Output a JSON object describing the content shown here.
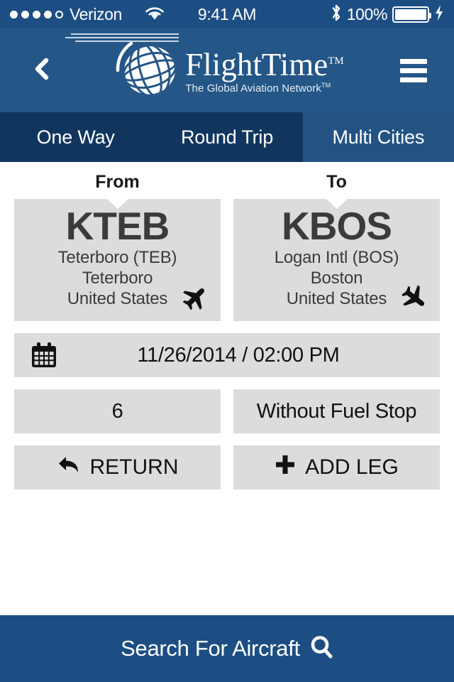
{
  "statusbar": {
    "carrier": "Verizon",
    "signal_dots_filled": 4,
    "signal_dots_total": 5,
    "wifi_icon": "wifi-icon",
    "time": "9:41 AM",
    "bluetooth_icon": "bluetooth-icon",
    "battery_percent": "100%",
    "charging_icon": "lightning-bolt-icon"
  },
  "header": {
    "back_icon": "chevron-left-icon",
    "menu_icon": "hamburger-menu-icon",
    "logo_icon": "globe-icon",
    "logo_word_a": "Flight",
    "logo_word_b": "Time",
    "logo_tm": "TM",
    "tagline": "The Global Aviation Network",
    "tagline_tm": "TM",
    "background_color": "#245687"
  },
  "tabs": [
    {
      "label": "One Way",
      "active": false
    },
    {
      "label": "Round Trip",
      "active": false
    },
    {
      "label": "Multi Cities",
      "active": true
    }
  ],
  "trip": {
    "from_label": "From",
    "to_label": "To",
    "from": {
      "code": "KTEB",
      "airport": "Teterboro (TEB)",
      "city": "Teterboro",
      "country": "United States",
      "icon": "airplane-departure-icon"
    },
    "to": {
      "code": "KBOS",
      "airport": "Logan Intl (BOS)",
      "city": "Boston",
      "country": "United States",
      "icon": "airplane-arrival-icon"
    },
    "date_icon": "calendar-icon",
    "datetime": "11/26/2014 / 02:00 PM",
    "passengers": "6",
    "fuel_stop": "Without Fuel Stop",
    "return_icon": "back-arrow-icon",
    "return_label": "RETURN",
    "add_leg_icon": "plus-icon",
    "add_leg_label": "ADD LEG"
  },
  "footer": {
    "search_label": "Search For Aircraft",
    "search_icon": "magnifier-icon",
    "background_color": "#1d4e83"
  },
  "colors": {
    "status_blue": "#1d4e83",
    "header_blue": "#245687",
    "tabbar_blue": "#11365e",
    "active_tab_blue": "#235383",
    "field_gray": "#dcdcdc",
    "text_dark": "#3b3b3b"
  }
}
